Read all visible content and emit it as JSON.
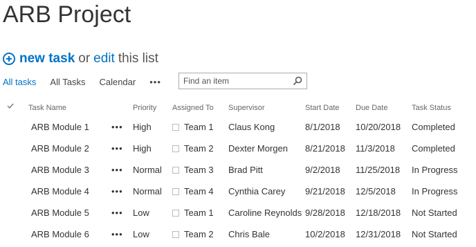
{
  "page": {
    "title": "ARB Project"
  },
  "actions": {
    "new_task": "new task",
    "or": "or",
    "edit": "edit",
    "this_list": "this list"
  },
  "views": {
    "tabs": [
      "All tasks",
      "All Tasks",
      "Calendar"
    ],
    "active": "All tasks",
    "more": "•••"
  },
  "search": {
    "placeholder": "Find an item",
    "value": ""
  },
  "table": {
    "columns": [
      "Task Name",
      "Priority",
      "Assigned To",
      "Supervisor",
      "Start Date",
      "Due Date",
      "Task Status"
    ],
    "row_menu": "•••",
    "rows": [
      {
        "name": "ARB Module 1",
        "priority": "High",
        "assigned": "Team 1",
        "supervisor": "Claus Kong",
        "start": "8/1/2018",
        "due": "10/20/2018",
        "status": "Completed"
      },
      {
        "name": "ARB Module 2",
        "priority": "High",
        "assigned": "Team 2",
        "supervisor": "Dexter Morgen",
        "start": "8/21/2018",
        "due": "11/3/2018",
        "status": "Completed"
      },
      {
        "name": "ARB Module 3",
        "priority": "Normal",
        "assigned": "Team 3",
        "supervisor": "Brad Pitt",
        "start": "9/2/2018",
        "due": "11/25/2018",
        "status": "In Progress"
      },
      {
        "name": "ARB Module 4",
        "priority": "Normal",
        "assigned": "Team 4",
        "supervisor": "Cynthia Carey",
        "start": "9/21/2018",
        "due": "12/5/2018",
        "status": "In Progress"
      },
      {
        "name": "ARB Module 5",
        "priority": "Low",
        "assigned": "Team 1",
        "supervisor": "Caroline Reynolds",
        "start": "9/28/2018",
        "due": "12/18/2018",
        "status": "Not Started"
      },
      {
        "name": "ARB Module 6",
        "priority": "Low",
        "assigned": "Team 2",
        "supervisor": "Chris Bale",
        "start": "10/2/2018",
        "due": "12/31/2018",
        "status": "Not Started"
      }
    ]
  },
  "colors": {
    "accent": "#0072c6",
    "text": "#333333",
    "muted": "#666666"
  }
}
